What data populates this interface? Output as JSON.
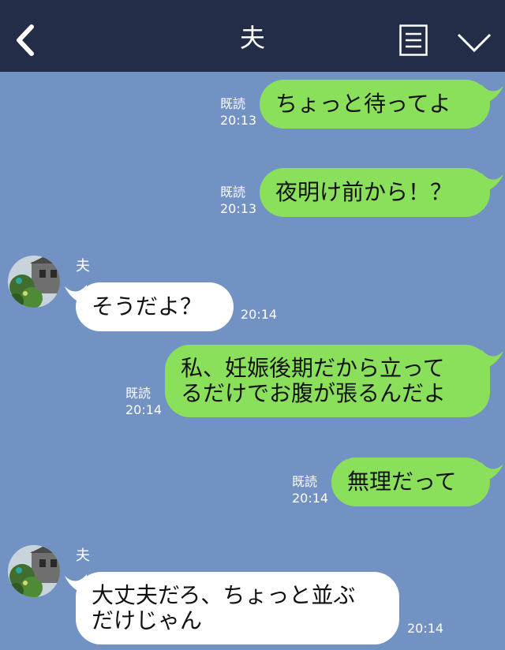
{
  "header": {
    "title": "夫",
    "back_icon": "chevron-left-icon",
    "memo_icon": "memo-list-icon",
    "menu_icon": "chevron-down-icon"
  },
  "colors": {
    "header_bg": "#232d48",
    "chat_bg": "#7392c4",
    "my_bubble": "#8ae05a",
    "their_bubble": "#ffffff"
  },
  "messages": [
    {
      "from": "me",
      "text": "ちょっと待ってよ",
      "read": "既読",
      "time": "20:13"
    },
    {
      "from": "me",
      "text": "夜明け前から！？",
      "read": "既読",
      "time": "20:13"
    },
    {
      "from": "夫",
      "sender": "夫",
      "text": "そうだよ？",
      "time": "20:14"
    },
    {
      "from": "me",
      "line1": "私、妊娠後期だから立って",
      "line2": "るだけでお腹が張るんだよ",
      "read": "既読",
      "time": "20:14"
    },
    {
      "from": "me",
      "text": "無理だって",
      "read": "既読",
      "time": "20:14"
    },
    {
      "from": "夫",
      "sender": "夫",
      "line1": "大丈夫だろ、ちょっと並ぶ",
      "line2": "だけじゃん",
      "time": "20:14"
    }
  ]
}
